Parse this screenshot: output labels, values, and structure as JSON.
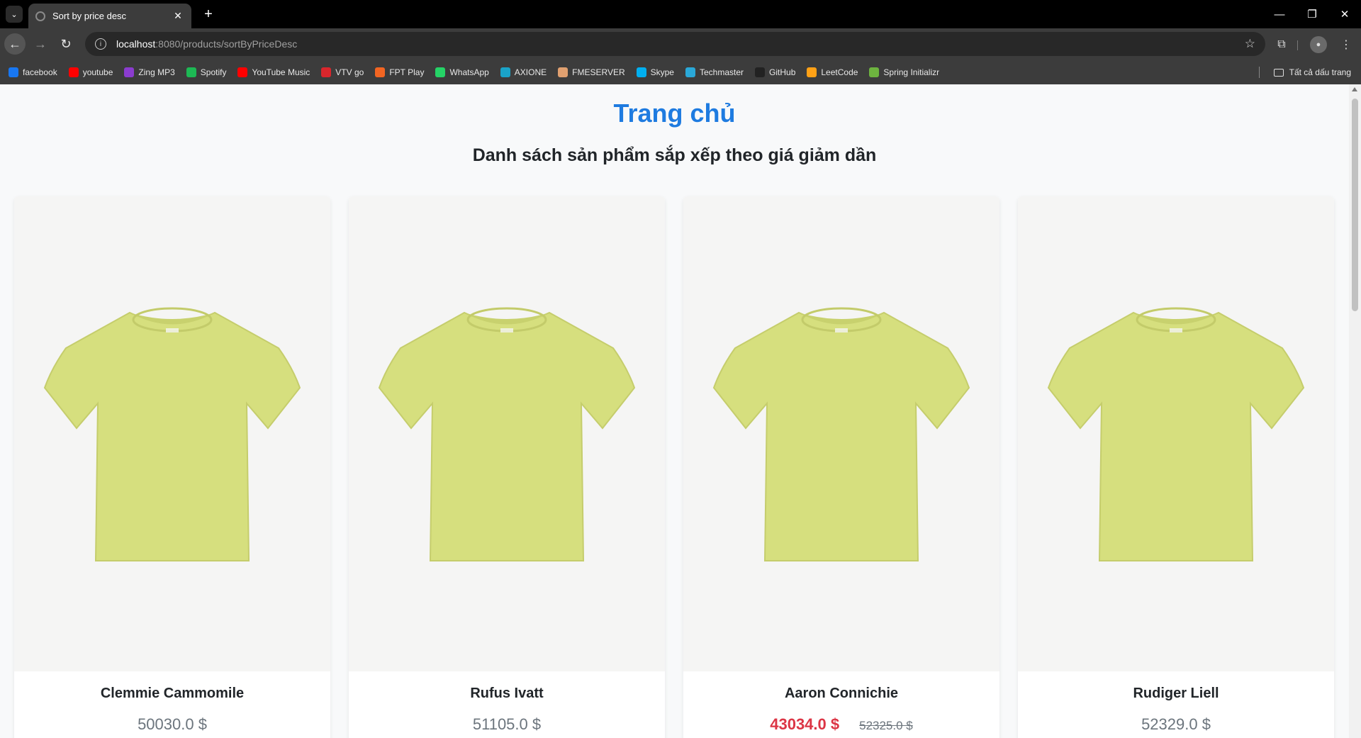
{
  "browser": {
    "tab_title": "Sort by price desc",
    "url_host": "localhost",
    "url_path": ":8080/products/sortByPriceDesc",
    "bookmarks": [
      {
        "label": "facebook",
        "color": "#1877f2",
        "icon": "facebook-icon"
      },
      {
        "label": "youtube",
        "color": "#ff0000",
        "icon": "youtube-icon"
      },
      {
        "label": "Zing MP3",
        "color": "#8b3ccf",
        "icon": "zing-mp3-icon"
      },
      {
        "label": "Spotify",
        "color": "#1db954",
        "icon": "spotify-icon"
      },
      {
        "label": "YouTube Music",
        "color": "#ff0000",
        "icon": "youtube-music-icon"
      },
      {
        "label": "VTV go",
        "color": "#d9262c",
        "icon": "vtv-go-icon"
      },
      {
        "label": "FPT Play",
        "color": "#f26522",
        "icon": "fpt-play-icon"
      },
      {
        "label": "WhatsApp",
        "color": "#25d366",
        "icon": "whatsapp-icon"
      },
      {
        "label": "AXIONE",
        "color": "#1aa3c8",
        "icon": "axione-icon"
      },
      {
        "label": "FMESERVER",
        "color": "#e0a070",
        "icon": "fmeserver-icon"
      },
      {
        "label": "Skype",
        "color": "#00aff0",
        "icon": "skype-icon"
      },
      {
        "label": "Techmaster",
        "color": "#2aa8d8",
        "icon": "techmaster-icon"
      },
      {
        "label": "GitHub",
        "color": "#222222",
        "icon": "github-icon"
      },
      {
        "label": "LeetCode",
        "color": "#ffa116",
        "icon": "leetcode-icon"
      },
      {
        "label": "Spring Initializr",
        "color": "#6db33f",
        "icon": "spring-icon"
      }
    ],
    "all_bookmarks_label": "Tất cả dấu trang"
  },
  "page": {
    "title": "Trang chủ",
    "subtitle": "Danh sách sản phẩm sắp xếp theo giá giảm dần"
  },
  "products": [
    {
      "name": "Clemmie Cammomile",
      "price": "50030.0 $"
    },
    {
      "name": "Rufus Ivatt",
      "price": "51105.0 $"
    },
    {
      "name": "Aaron Connichie",
      "sale_price": "43034.0 $",
      "old_price": "52325.0 $"
    },
    {
      "name": "Rudiger Liell",
      "price": "52329.0 $"
    }
  ],
  "colors": {
    "accent": "#1e7be0",
    "sale": "#dc3545",
    "shirt": "#d6df7e"
  }
}
